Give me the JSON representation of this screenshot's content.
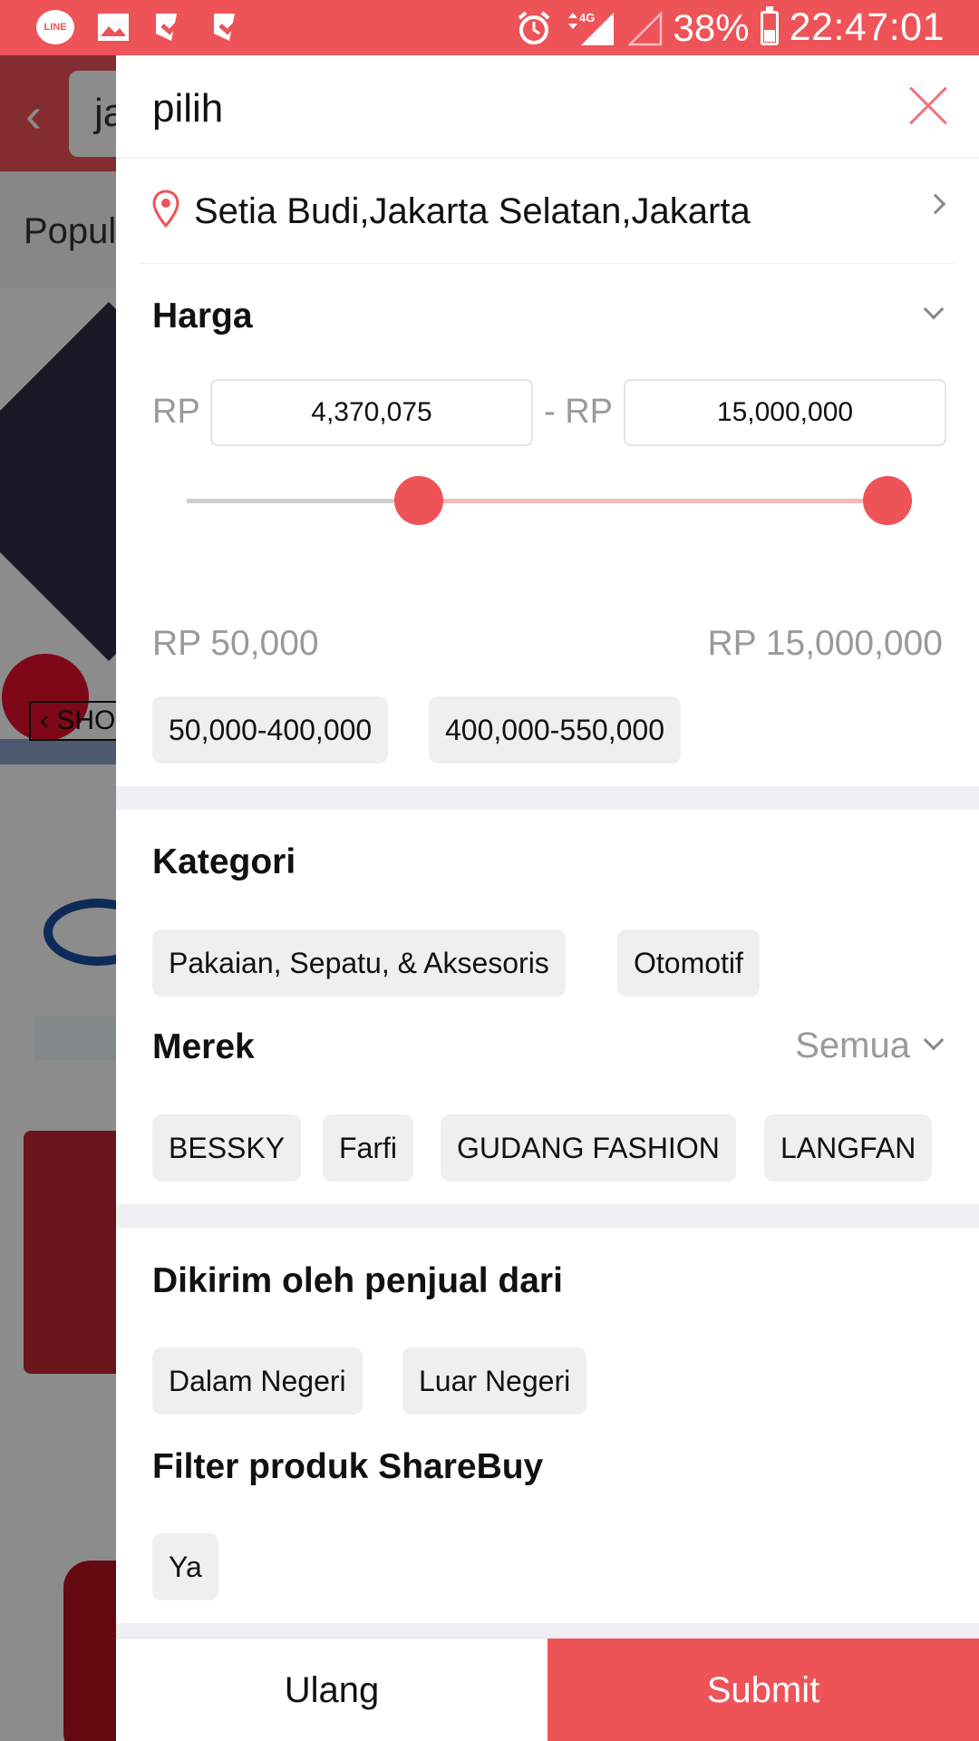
{
  "status_bar": {
    "battery": "38%",
    "time": "22:47:01",
    "network": "4G",
    "notification_icons": [
      "line-icon",
      "image-icon",
      "task-icon",
      "task-icon"
    ]
  },
  "background": {
    "search_text": "ja",
    "tab_label": "Popul",
    "banner_label": "SHO"
  },
  "drawer": {
    "title": "pilih",
    "location": "Setia Budi,Jakarta Selatan,Jakarta",
    "price": {
      "title": "Harga",
      "currency": "RP",
      "separator": "- RP",
      "min_value": "4,370,075",
      "max_value": "15,000,000",
      "range_min_label": "RP 50,000",
      "range_max_label": "RP 15,000,000",
      "slider_low_fraction": 0.29,
      "slider_high_fraction": 1.0,
      "presets": [
        "50,000-400,000",
        "400,000-550,000"
      ]
    },
    "category": {
      "title": "Kategori",
      "options": [
        "Pakaian, Sepatu, & Aksesoris",
        "Otomotif"
      ]
    },
    "brand": {
      "title": "Merek",
      "all_label": "Semua",
      "options": [
        "BESSKY",
        "Farfi",
        "GUDANG FASHION",
        "LANGFAN"
      ]
    },
    "shipped_from": {
      "title": "Dikirim oleh penjual dari",
      "options": [
        "Dalam Negeri",
        "Luar Negeri"
      ]
    },
    "sharebuy": {
      "title": "Filter produk ShareBuy",
      "options": [
        "Ya"
      ]
    },
    "footer": {
      "reset_label": "Ulang",
      "submit_label": "Submit"
    }
  },
  "colors": {
    "accent": "#ee5358",
    "slider_fill": "#f7b8ba",
    "chip_bg": "#efefef",
    "muted_text": "#9a9a9a"
  }
}
